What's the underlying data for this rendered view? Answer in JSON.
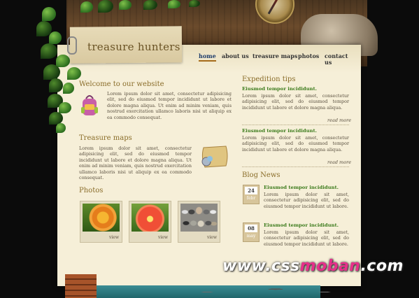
{
  "site": {
    "title": "treasure hunters"
  },
  "nav": [
    {
      "label": "home",
      "active": true
    },
    {
      "label": "about us",
      "active": false
    },
    {
      "label": "treasure maps",
      "active": false
    },
    {
      "label": "photos",
      "active": false
    },
    {
      "label": "contact us",
      "active": false
    }
  ],
  "welcome": {
    "heading": "Welcome to our website",
    "text": "Lorem ipsum dolor sit amet, consectetur adipisicing elit, sed do eiusmod tempor incididunt ut labore et dolore magna aliqua. Ut enim ad minim veniam, quis nostrud exercitation ullamco laboris nisi ut aliquip ex ea commodo consequat.",
    "icon": "backpack-icon"
  },
  "treasure_maps": {
    "heading": "Treasure maps",
    "text": "Lorem ipsum dolor sit amet, consectetur adipisicing elit, sed do eiusmod tempor incididunt ut labore et dolore magna aliqua. Ut enim ad minim veniam, quis nostrud exercitation ullamco laboris nisi ut aliquip ex ea commodo consequat.",
    "icon": "map-scroll-icon"
  },
  "photos": {
    "heading": "Photos",
    "items": [
      {
        "label": "view",
        "subject": "orange flower"
      },
      {
        "label": "view",
        "subject": "red dahlia"
      },
      {
        "label": "view",
        "subject": "stones"
      }
    ]
  },
  "expedition": {
    "heading": "Expedition tips",
    "items": [
      {
        "title": "Eiusmod tempor incididunt.",
        "text": "Lorem ipsum dolor sit amet, consectetur adipisicing elit, sed do eiusmod tempor incididunt ut labore et dolore magna aliqua.",
        "more": "read more"
      },
      {
        "title": "Eiusmod tempor incididunt.",
        "text": "Lorem ipsum dolor sit amet, consectetur adipisicing elit, sed do eiusmod tempor incididunt ut labore et dolore magna aliqua.",
        "more": "read more"
      }
    ]
  },
  "blog": {
    "heading": "Blog News",
    "items": [
      {
        "day": "24",
        "month": "febr",
        "title": "Eiusmod tempor incididunt.",
        "text": "Lorem ipsum dolor sit amet, consectetur adipisicing elit, sed do eiusmod tempor incididunt ut labore."
      },
      {
        "day": "08",
        "month": "may",
        "title": "Eiusmod tempor incididunt.",
        "text": "Lorem ipsum dolor sit amet, consectetur adipisicing elit, sed do eiusmod tempor incididunt ut labore."
      }
    ]
  },
  "watermark": {
    "part1": "www.css",
    "part2": "moban",
    "part3": ".com"
  },
  "colors": {
    "parchment": "#f6efd8",
    "heading": "#8a6d2a",
    "green_title": "#3a7a1a",
    "nav_active": "#1e3d6b"
  }
}
